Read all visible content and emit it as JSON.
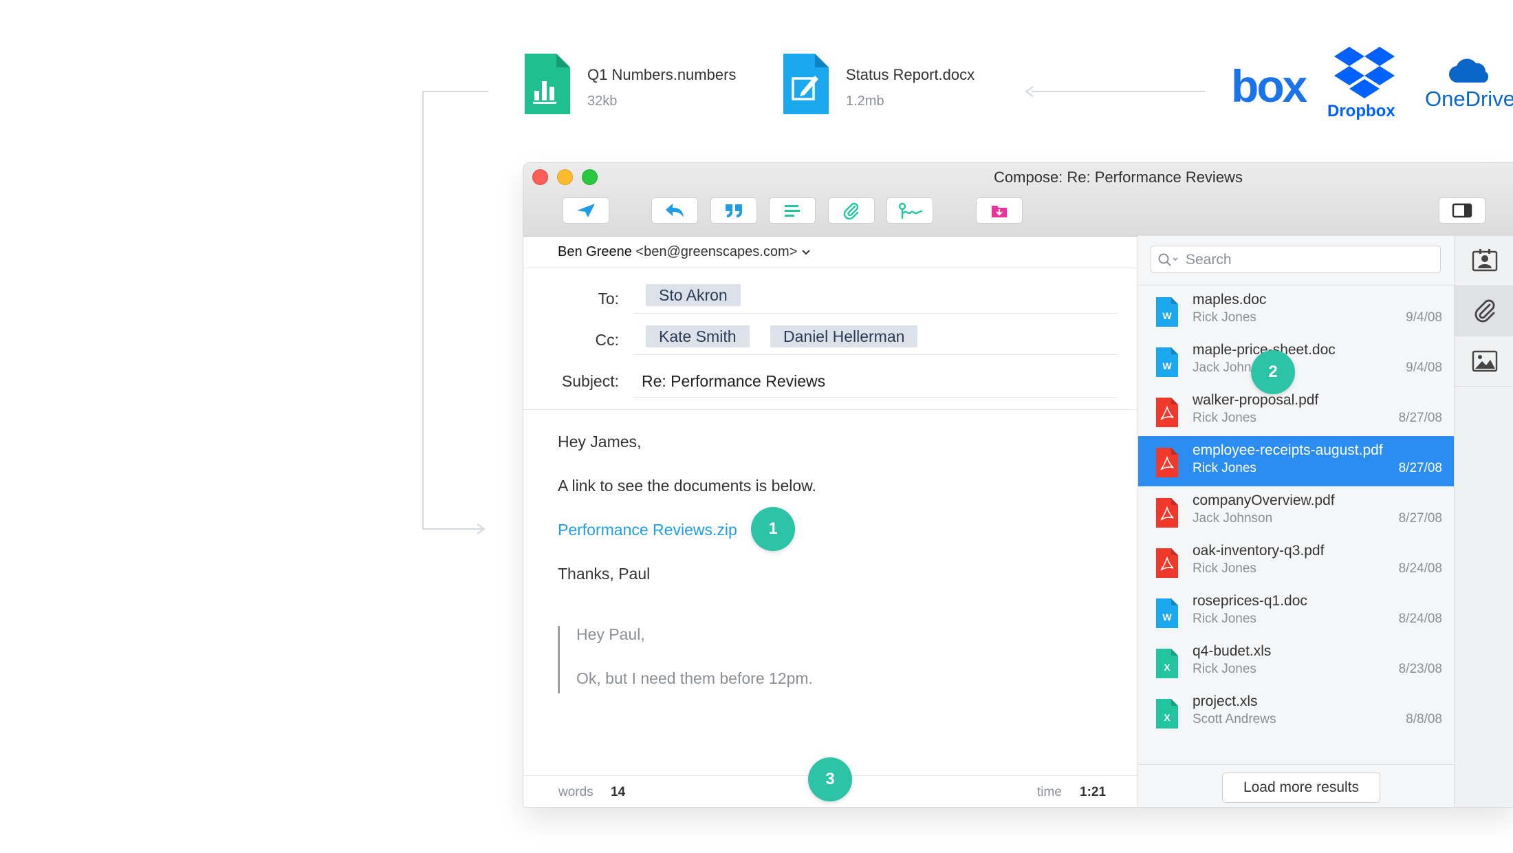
{
  "files": [
    {
      "name": "Q1 Numbers.numbers",
      "size": "32kb",
      "type": "numbers",
      "color": "#1fbf8f"
    },
    {
      "name": "Status Report.docx",
      "size": "1.2mb",
      "type": "docx",
      "color": "#1ba8ef"
    }
  ],
  "cloud_services": {
    "box": "box",
    "dropbox": "Dropbox",
    "onedrive": "OneDrive"
  },
  "window": {
    "title": "Compose: Re: Performance Reviews",
    "toolbar": [
      "send-icon",
      "reply-icon",
      "quote-icon",
      "format-icon",
      "attachment-icon",
      "signature-icon",
      "save-to-cloud-icon",
      "sidebar-toggle-icon"
    ]
  },
  "compose": {
    "sender_name": "Ben Greene",
    "sender_email": "<ben@greenscapes.com>",
    "to_label": "To:",
    "to": [
      "Sto Akron"
    ],
    "cc_label": "Cc:",
    "cc": [
      "Kate Smith",
      "Daniel Hellerman"
    ],
    "subject_label": "Subject:",
    "subject": "Re: Performance Reviews",
    "body": {
      "greeting": "Hey James,",
      "line1": "A link to see the documents is below.",
      "link": "Performance Reviews.zip",
      "closing": "Thanks, Paul"
    },
    "quote": {
      "line1": "Hey Paul,",
      "line2": "Ok, but I need them before 12pm."
    },
    "footer": {
      "words_label": "words",
      "words": "14",
      "time_label": "time",
      "time": "1:21"
    }
  },
  "badges": [
    "1",
    "2",
    "3"
  ],
  "attachments": {
    "search_placeholder": "Search",
    "items": [
      {
        "name": "maples.doc",
        "author": "Rick Jones",
        "date": "9/4/08",
        "kind": "doc"
      },
      {
        "name": "maple-price-sheet.doc",
        "author": "Jack Johnson",
        "date": "9/4/08",
        "kind": "doc"
      },
      {
        "name": "walker-proposal.pdf",
        "author": "Rick Jones",
        "date": "8/27/08",
        "kind": "pdf"
      },
      {
        "name": "employee-receipts-august.pdf",
        "author": "Rick Jones",
        "date": "8/27/08",
        "kind": "pdf",
        "selected": true
      },
      {
        "name": "companyOverview.pdf",
        "author": "Jack Johnson",
        "date": "8/27/08",
        "kind": "pdf"
      },
      {
        "name": "oak-inventory-q3.pdf",
        "author": "Rick Jones",
        "date": "8/24/08",
        "kind": "pdf"
      },
      {
        "name": "roseprices-q1.doc",
        "author": "Rick Jones",
        "date": "8/24/08",
        "kind": "doc"
      },
      {
        "name": "q4-budet.xls",
        "author": "Rick Jones",
        "date": "8/23/08",
        "kind": "xls"
      },
      {
        "name": "project.xls",
        "author": "Scott Andrews",
        "date": "8/8/08",
        "kind": "xls"
      }
    ],
    "load_more": "Load more results"
  },
  "colors": {
    "accent": "#2c8df1",
    "badge": "#2dc3a6",
    "doc": "#1ba8ef",
    "pdf": "#f0392b",
    "xls": "#22c5a0"
  }
}
